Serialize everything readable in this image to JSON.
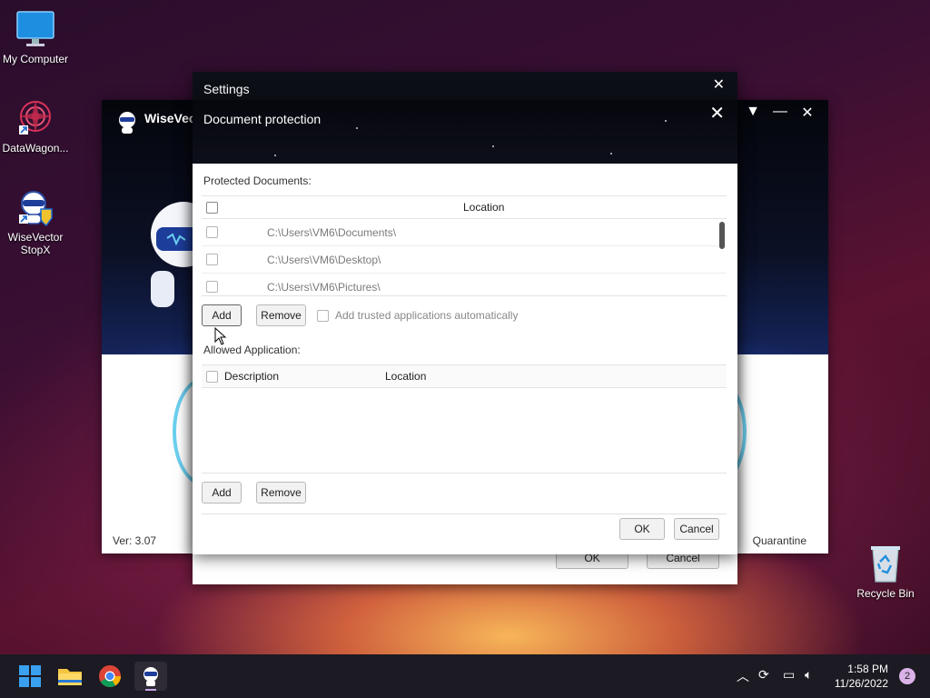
{
  "desktop": {
    "icons": [
      {
        "label": "My Computer",
        "icon": "monitor-icon"
      },
      {
        "label": "DataWagon...",
        "icon": "datawagon-icon"
      },
      {
        "label": "WiseVector StopX",
        "icon": "wisevector-icon"
      },
      {
        "label": "Recycle Bin",
        "icon": "recycle-bin-icon"
      }
    ]
  },
  "wisevector": {
    "title": "WiseVec",
    "version": "Ver: 3.07",
    "quarantine": "Quarantine"
  },
  "settings": {
    "title": "Settings",
    "ok_label": "OK",
    "cancel_label": "Cancel"
  },
  "dialog": {
    "title": "Document protection",
    "protected_label": "Protected Documents:",
    "location_header": "Location",
    "rows": [
      {
        "location": "C:\\Users\\VM6\\Documents\\"
      },
      {
        "location": "C:\\Users\\VM6\\Desktop\\"
      },
      {
        "location": "C:\\Users\\VM6\\Pictures\\"
      }
    ],
    "add_label": "Add",
    "remove_label": "Remove",
    "trusted_label": "Add trusted applications automatically",
    "allowed_label": "Allowed Application:",
    "description_header": "Description",
    "app_location_header": "Location",
    "add2_label": "Add",
    "remove2_label": "Remove",
    "ok_label": "OK",
    "cancel_label": "Cancel"
  },
  "taskbar": {
    "time": "1:58 PM",
    "date": "11/26/2022",
    "notifications": "2"
  },
  "colors": {
    "accent_dark": "#0d0f17",
    "wv_blue": "#1c3f9a",
    "taskbar": "#1c1a22"
  }
}
